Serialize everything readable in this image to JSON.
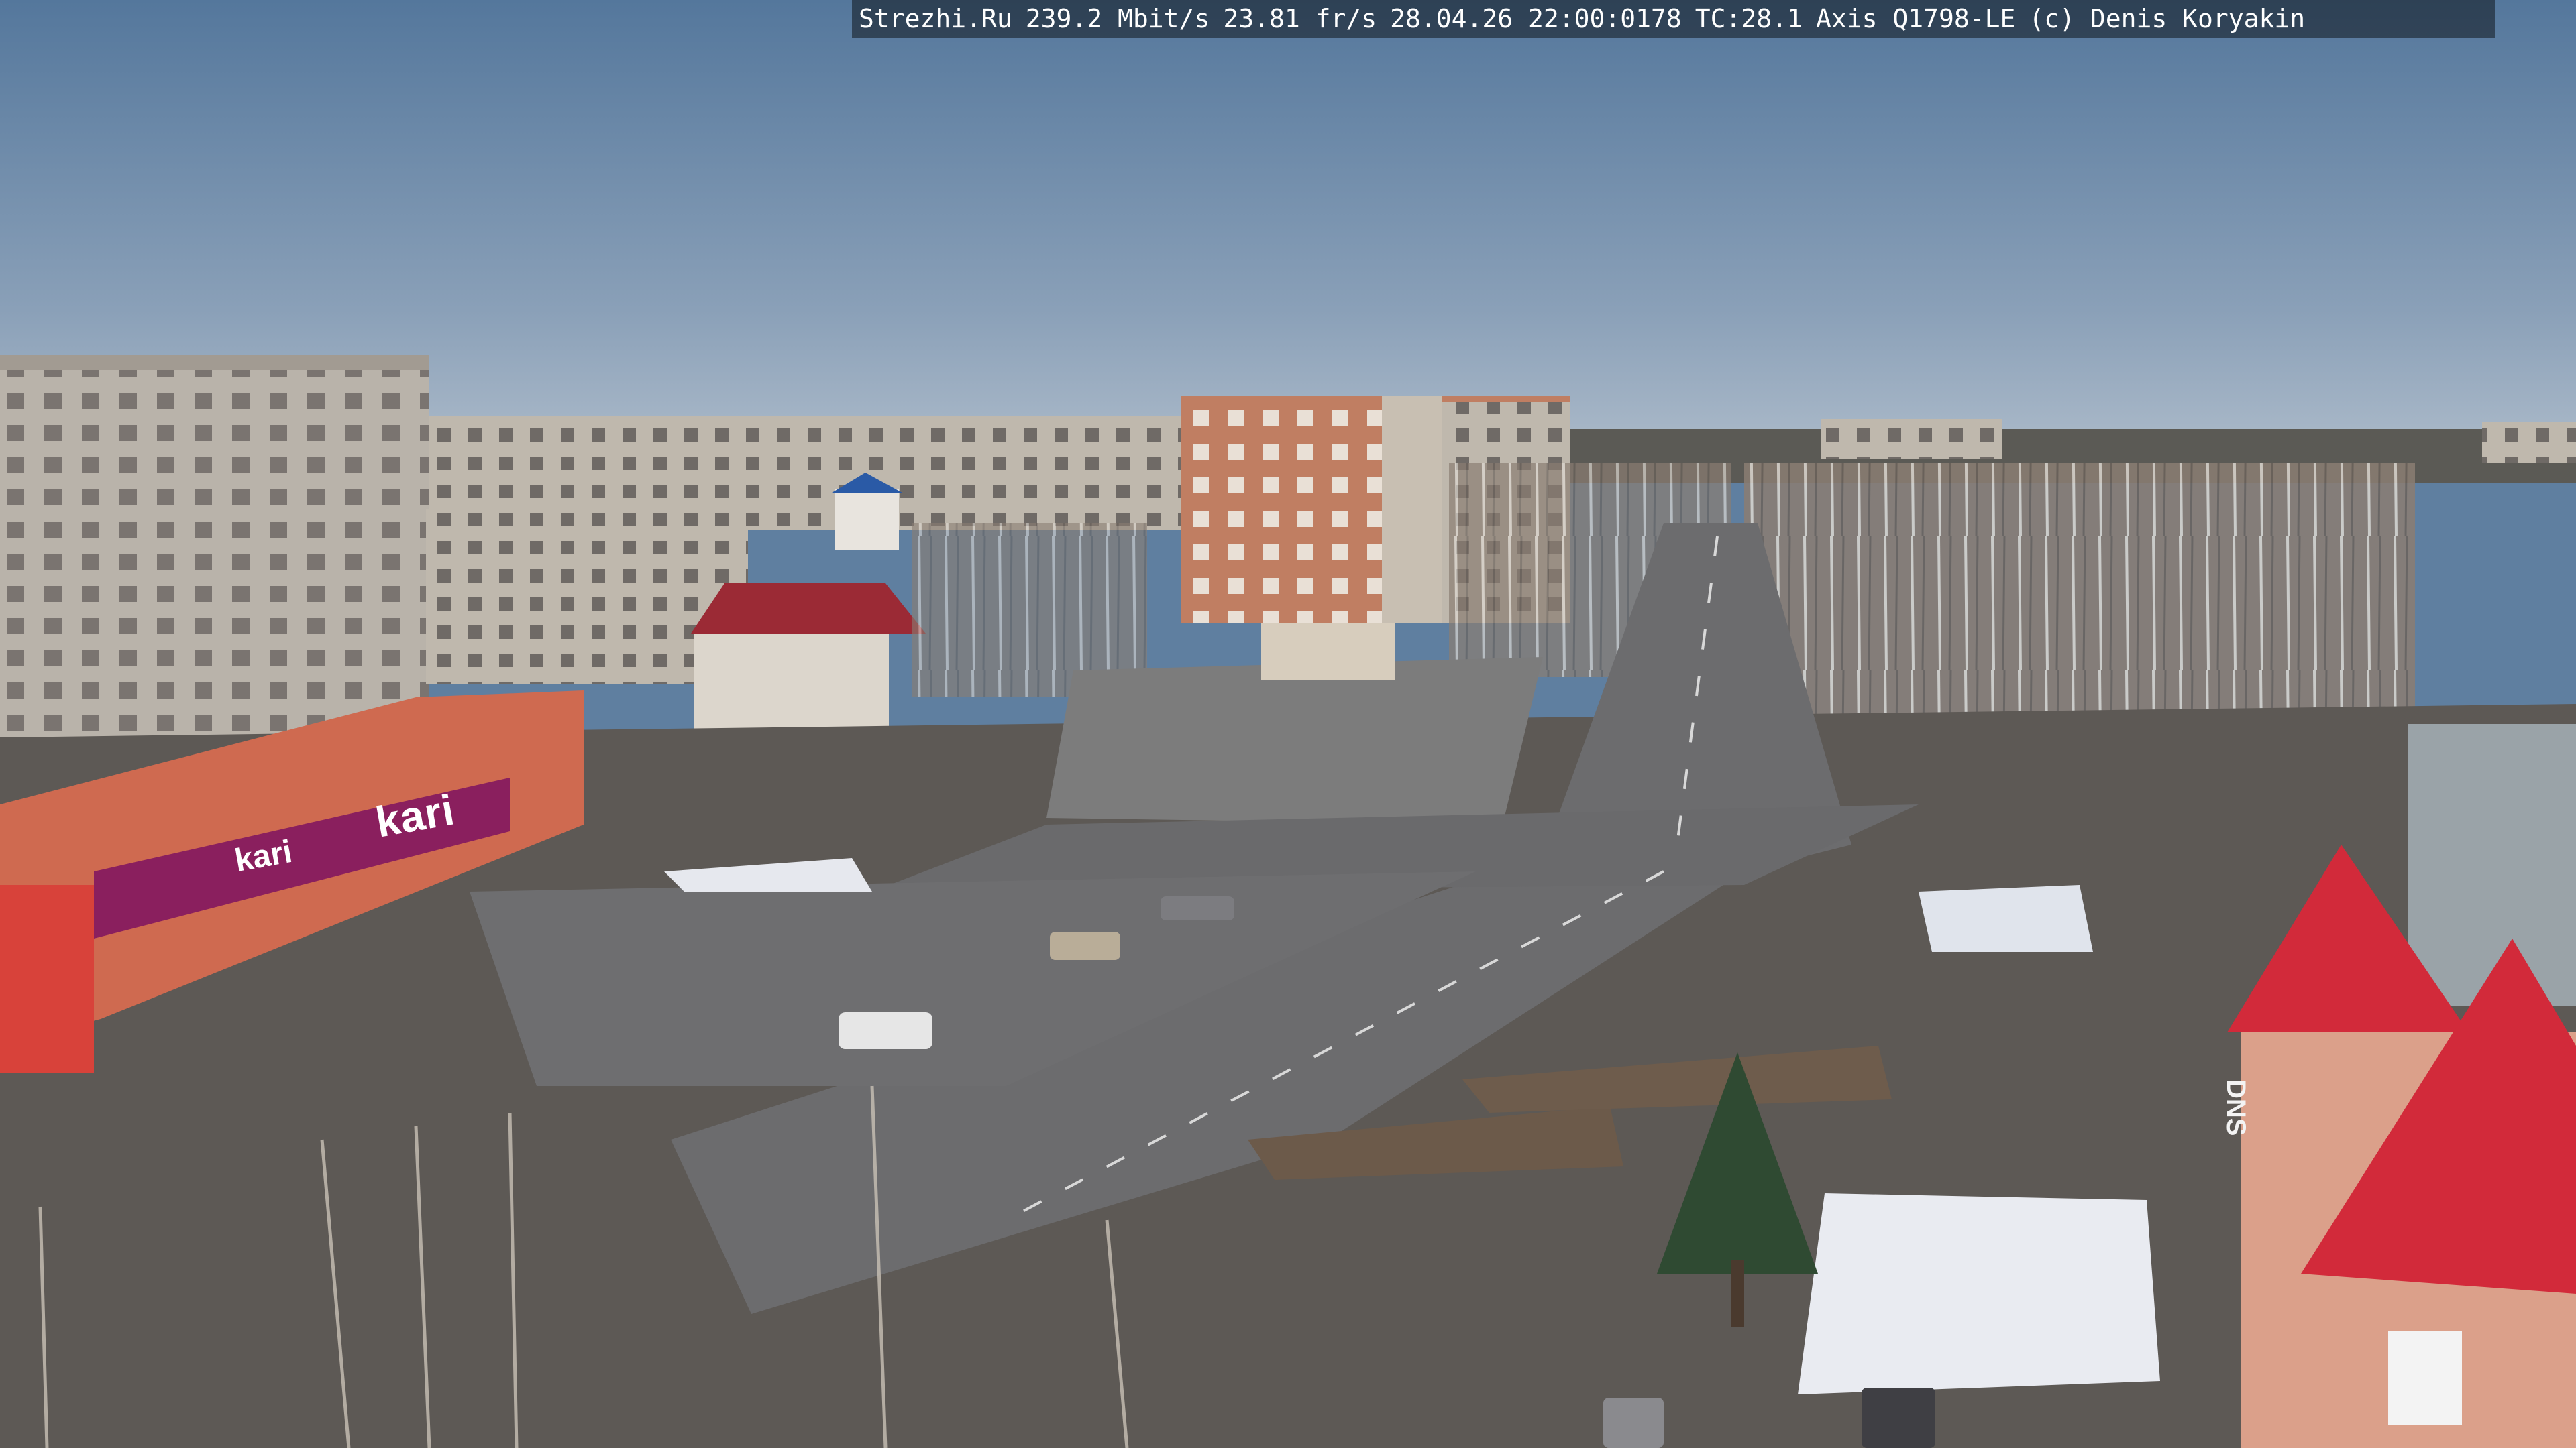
{
  "overlay": {
    "site": "Strezhi.Ru",
    "bitrate": "239.2 Mbit/s",
    "framerate": "23.81 fr/s",
    "datetime": "28.04.26 22:00:0178",
    "tc": "TC:28.1",
    "camera": "Axis Q1798-LE",
    "copyright": "(c) Denis Koryakin"
  },
  "signs": {
    "store_main": "kari",
    "store_secondary": "kari",
    "right_building": "DNS"
  },
  "colors": {
    "sky_top": "#5a7ca0",
    "sky_horizon": "#a6b6c6",
    "ground": "#5e5a55",
    "road": "#6e6e70",
    "brick": "#d06a52",
    "roof_red": "#d22a3a",
    "store_purple": "#8a1f5e"
  }
}
